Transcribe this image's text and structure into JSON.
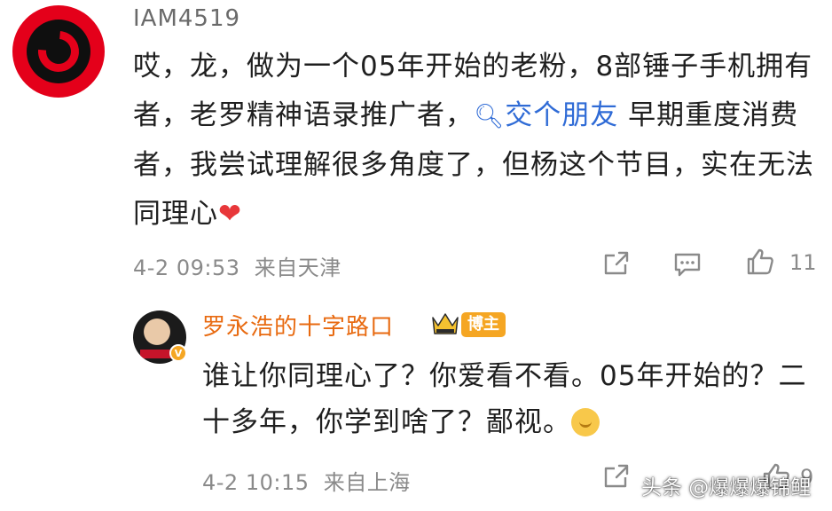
{
  "main_comment": {
    "username": "IAM4519",
    "text_before_link": "哎，龙，做为一个05年开始的老粉，8部锤子手机拥有者，老罗精神语录推广者，",
    "search_link_label": "交个朋友",
    "text_after_link": " 早期重度消费者，我尝试理解很多角度了，但杨这个节目，实在无法同理心",
    "heart": "❤",
    "timestamp": "4-2 09:53",
    "location": "来自天津",
    "like_count": "11"
  },
  "reply": {
    "username": "罗永浩的十字路口",
    "badge": "博主",
    "text": "谁让你同理心了？你爱看不看。05年开始的？二十多年，你学到啥了？鄙视。",
    "timestamp": "4-2 10:15",
    "location": "来自上海",
    "like_count": "9"
  },
  "watermark": "头条 @爆爆爆锦鲤",
  "colors": {
    "link": "#2f6bd6",
    "reply_username": "#e86a10",
    "badge": "#f5a623",
    "meta": "#8a8a8a"
  }
}
